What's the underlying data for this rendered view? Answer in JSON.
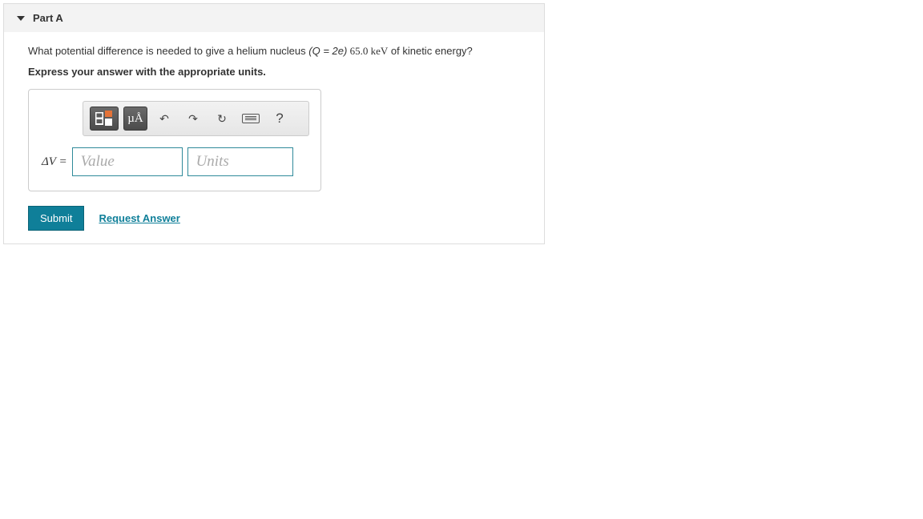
{
  "part": {
    "label": "Part A",
    "question_prefix": "What potential difference is needed to give a helium nucleus ",
    "question_paren_var": "Q",
    "question_paren_eq": " = 2",
    "question_paren_e": "e",
    "question_value": " 65.0 ",
    "question_unit": "keV",
    "question_suffix": " of kinetic energy?",
    "instruction": "Express your answer with the appropriate units."
  },
  "toolbar": {
    "template_icon": "template-icon",
    "units_icon_label": "µÅ",
    "undo_icon": "↶",
    "redo_icon": "↷",
    "reset_icon": "↻",
    "keyboard_icon": "keyboard-icon",
    "help_icon": "?"
  },
  "answer": {
    "lhs": "ΔV =",
    "value_placeholder": "Value",
    "units_placeholder": "Units"
  },
  "actions": {
    "submit": "Submit",
    "request": "Request Answer"
  }
}
